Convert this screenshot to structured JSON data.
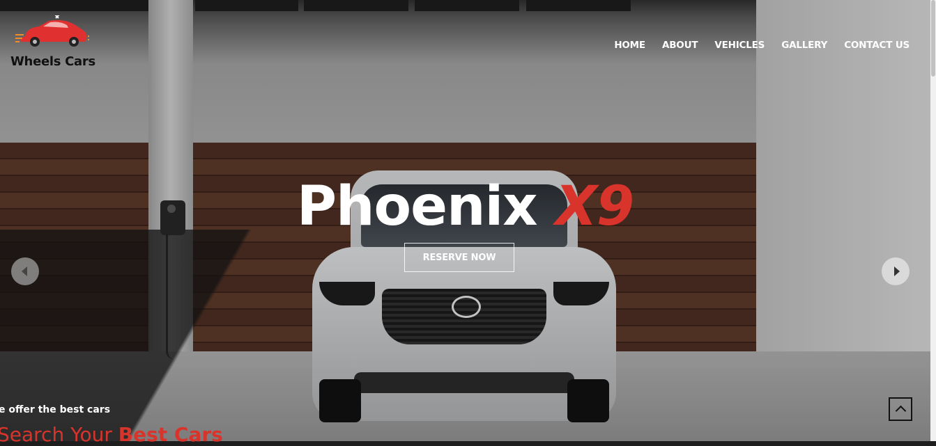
{
  "brand": {
    "name": "Wheels Cars"
  },
  "nav": {
    "items": [
      {
        "label": "HOME"
      },
      {
        "label": "ABOUT"
      },
      {
        "label": "VEHICLES"
      },
      {
        "label": "GALLERY"
      },
      {
        "label": "CONTACT US"
      }
    ]
  },
  "hero": {
    "title_main": "Phoenix",
    "title_accent": "X9",
    "cta_label": "RESERVE NOW"
  },
  "section": {
    "tagline": "e offer the best cars",
    "title_light": "Search Your ",
    "title_bold": "Best Cars"
  },
  "colors": {
    "accent": "#d8342c",
    "nav_text": "#ffffff"
  },
  "icons": {
    "prev": "chevron-left-icon",
    "next": "chevron-right-icon",
    "to_top": "chevron-up-icon"
  }
}
